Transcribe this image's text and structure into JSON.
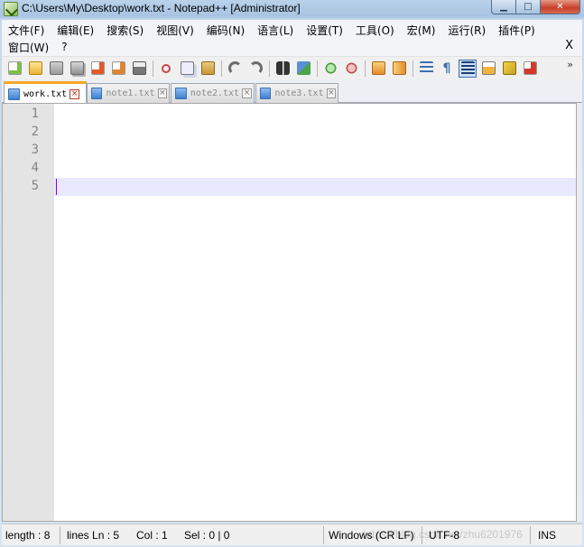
{
  "window": {
    "title": "C:\\Users\\My\\Desktop\\work.txt - Notepad++ [Administrator]",
    "minimize_glyph": "▁",
    "maximize_glyph": "□",
    "close_glyph": "✕"
  },
  "menu": {
    "row1": [
      "文件(F)",
      "编辑(E)",
      "搜索(S)",
      "视图(V)",
      "编码(N)",
      "语言(L)",
      "设置(T)",
      "工具(O)",
      "宏(M)",
      "运行(R)",
      "插件(P)"
    ],
    "row2": [
      "窗口(W)",
      "?"
    ],
    "close_label": "X"
  },
  "toolbar": {
    "icons": [
      "new-file-icon",
      "open-file-icon",
      "save-icon",
      "save-all-icon",
      "close-icon",
      "close-all-icon",
      "print-icon",
      "cut-icon",
      "copy-icon",
      "paste-icon",
      "undo-icon",
      "redo-icon",
      "find-icon",
      "replace-icon",
      "zoom-in-icon",
      "zoom-out-icon",
      "sync-vertical-icon",
      "sync-horizontal-icon",
      "word-wrap-icon",
      "show-all-chars-icon",
      "indent-guide-icon",
      "document-map-icon",
      "function-list-icon",
      "macro-record-icon"
    ],
    "more_glyph": "»"
  },
  "tabs": [
    {
      "label": "work.txt",
      "active": true,
      "close_glyph": "×"
    },
    {
      "label": "note1.txt",
      "active": false,
      "close_glyph": "×"
    },
    {
      "label": "note2.txt",
      "active": false,
      "close_glyph": "×"
    },
    {
      "label": "note3.txt",
      "active": false,
      "close_glyph": "×"
    }
  ],
  "editor": {
    "line_numbers": [
      "1",
      "2",
      "3",
      "4",
      "5"
    ],
    "current_line": 5,
    "colors": {
      "current_line": "#e8e8ff",
      "caret": "#8000ff",
      "gutter": "#e4e4e4"
    }
  },
  "status": {
    "length": "length : 8",
    "lines": "lines Ln : 5",
    "col": "Col : 1",
    "sel": "Sel : 0 | 0",
    "eol": "Windows (CR LF)",
    "encoding": "UTF-8",
    "mode": "INS",
    "watermark": "https://blog.csdn.net/zhu6201976"
  }
}
